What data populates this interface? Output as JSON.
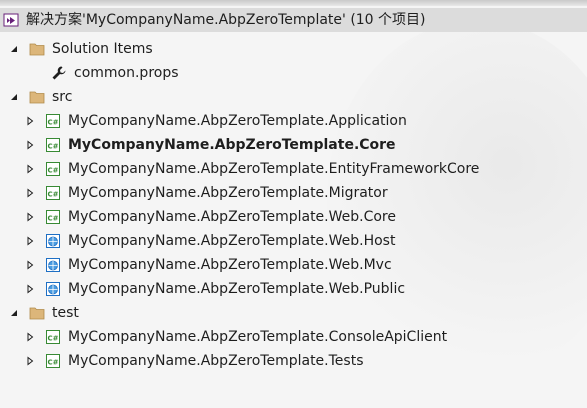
{
  "solution": {
    "label": "解决方案'MyCompanyName.AbpZeroTemplate' (10 个项目)",
    "icon": "visual-studio-solution-icon"
  },
  "folders": {
    "solution_items": {
      "label": "Solution Items",
      "icon": "folder-icon",
      "expanded": true
    },
    "src": {
      "label": "src",
      "icon": "folder-icon",
      "expanded": true
    },
    "test": {
      "label": "test",
      "icon": "folder-icon",
      "expanded": true
    }
  },
  "files": {
    "common_props": {
      "label": "common.props",
      "icon": "wrench-icon"
    }
  },
  "projects": {
    "application": {
      "label": "MyCompanyName.AbpZeroTemplate.Application",
      "icon": "csharp-project-icon"
    },
    "core": {
      "label": "MyCompanyName.AbpZeroTemplate.Core",
      "icon": "csharp-project-icon",
      "bold": true
    },
    "efcore": {
      "label": "MyCompanyName.AbpZeroTemplate.EntityFrameworkCore",
      "icon": "csharp-project-icon"
    },
    "migrator": {
      "label": "MyCompanyName.AbpZeroTemplate.Migrator",
      "icon": "csharp-project-icon"
    },
    "web_core": {
      "label": "MyCompanyName.AbpZeroTemplate.Web.Core",
      "icon": "csharp-project-icon"
    },
    "web_host": {
      "label": "MyCompanyName.AbpZeroTemplate.Web.Host",
      "icon": "web-project-icon"
    },
    "web_mvc": {
      "label": "MyCompanyName.AbpZeroTemplate.Web.Mvc",
      "icon": "web-project-icon"
    },
    "web_public": {
      "label": "MyCompanyName.AbpZeroTemplate.Web.Public",
      "icon": "web-project-icon"
    },
    "console_api_client": {
      "label": "MyCompanyName.AbpZeroTemplate.ConsoleApiClient",
      "icon": "csharp-project-icon"
    },
    "tests": {
      "label": "MyCompanyName.AbpZeroTemplate.Tests",
      "icon": "csharp-project-icon"
    }
  },
  "colors": {
    "selection": "#dcdcdc",
    "csharp_green": "#388a34",
    "folder_tan": "#dcb67a",
    "web_blue": "#1e6fc4",
    "vs_purple": "#68217a"
  }
}
